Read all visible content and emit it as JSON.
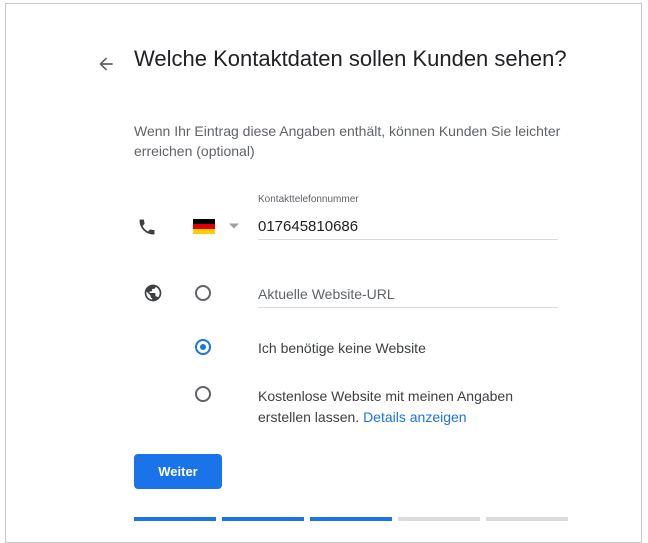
{
  "header": {
    "title": "Welche Kontaktdaten sollen Kunden sehen?",
    "subtitle": "Wenn Ihr Eintrag diese Angaben enthält, können Kunden Sie leichter erreichen (optional)"
  },
  "phone": {
    "label": "Kontakttelefonnummer",
    "value": "017645810686",
    "country_flag": "germany-flag",
    "icon": "phone-icon"
  },
  "website": {
    "icon": "globe-icon",
    "placeholder": "Aktuelle Website-URL",
    "selected_option": "no-website",
    "options": {
      "no_website": "Ich benötige keine Website",
      "create_text": "Kostenlose Website mit meinen Angaben erstellen lassen.",
      "create_link": "Details anzeigen"
    }
  },
  "actions": {
    "next_label": "Weiter"
  },
  "progress": {
    "completed_steps": 3,
    "total_steps": 5
  },
  "colors": {
    "accent": "#1a73e8",
    "text": "#202124",
    "muted": "#5f6368",
    "divider": "#dadce0"
  }
}
